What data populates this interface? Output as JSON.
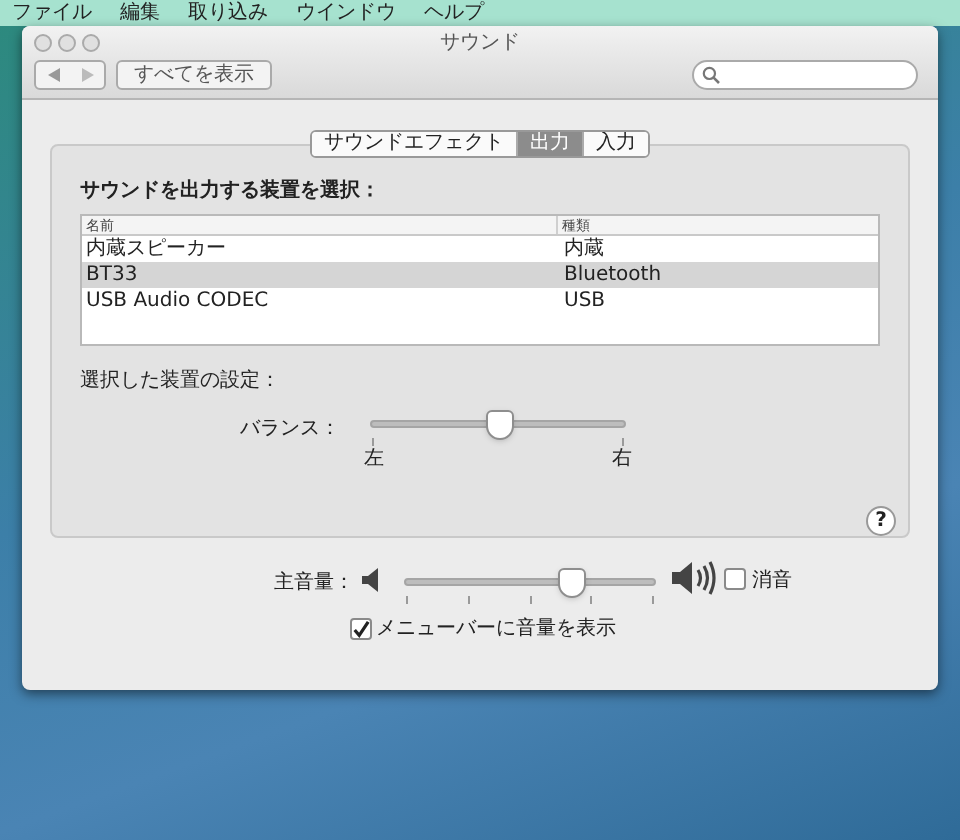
{
  "menu_bar": [
    "ファイル",
    "編集",
    "取り込み",
    "ウインドウ",
    "ヘルプ"
  ],
  "window": {
    "title": "サウンド"
  },
  "toolbar": {
    "show_all": "すべてを表示"
  },
  "tabs": [
    {
      "label": "サウンドエフェクト",
      "selected": false
    },
    {
      "label": "出力",
      "selected": true
    },
    {
      "label": "入力",
      "selected": false
    }
  ],
  "output": {
    "heading": "サウンドを出力する装置を選択：",
    "columns": [
      "名前",
      "種類"
    ],
    "rows": [
      {
        "name": "内蔵スピーカー",
        "type": "内蔵",
        "selected": false
      },
      {
        "name": "BT33",
        "type": "Bluetooth",
        "selected": true
      },
      {
        "name": "USB Audio CODEC",
        "type": "USB",
        "selected": false
      }
    ],
    "settings_heading": "選択した装置の設定：",
    "balance": {
      "label": "バランス：",
      "level": 0.51,
      "left": "左",
      "right": "右"
    },
    "help": "?"
  },
  "volume": {
    "label": "主音量：",
    "level": 0.67,
    "mute_label": "消音",
    "muted": false
  },
  "show_in_menu_bar": {
    "label": "メニューバーに音量を表示",
    "checked": true
  }
}
